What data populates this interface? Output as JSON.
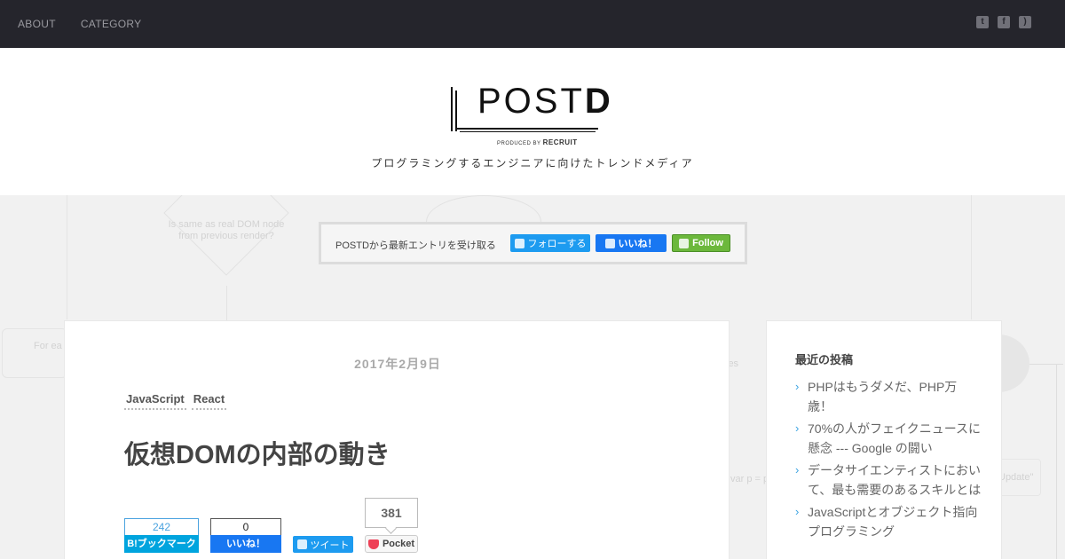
{
  "topnav": {
    "items": [
      "ABOUT",
      "CATEGORY"
    ],
    "social_icons": [
      "twitter-icon",
      "facebook-icon",
      "rss-icon"
    ]
  },
  "header": {
    "logo": {
      "brand": "POST",
      "brand_bold": "D",
      "produced_by": "PRODUCED BY",
      "recruit": "RECRUIT"
    },
    "tagline": "プログラミングするエンジニアに向けたトレンドメディア"
  },
  "hero": {
    "decision_text": "Is same as real DOM node from previous render?",
    "left_text": "For ea i",
    "right_text_1": "les",
    "right_text_2": "var p = p.remo",
    "right_text_3": "Update\""
  },
  "follow": {
    "text": "POSTDから最新エントリを受け取る",
    "twitter_label": "フォローする",
    "facebook_label": "いいね！",
    "feedly_label": "Follow"
  },
  "article": {
    "date": "2017年2月9日",
    "tags": [
      "JavaScript",
      "React"
    ],
    "title": "仮想DOMの内部の動き",
    "share": {
      "hatena_count": "242",
      "hatena_label": "B!ブックマーク",
      "facebook_count": "0",
      "facebook_label": "いいね！",
      "tweet_label": "ツイート",
      "pocket_count": "381",
      "pocket_label": "Pocket"
    }
  },
  "sidebar": {
    "title": "最近の投稿",
    "posts": [
      "PHPはもうダメだ、PHP万歳！",
      "70%の人がフェイクニュースに懸念 --- Google の闘い",
      "データサイエンティストにおいて、最も需要のあるスキルとは",
      "JavaScriptとオブジェクト指向プログラミング"
    ]
  },
  "colors": {
    "topbar": "#25252c",
    "twitter": "#1d9bf0",
    "facebook": "#1877f2",
    "feedly": "#6cb83c",
    "hatena": "#00a4de",
    "pocket": "#ee4056",
    "accent": "#3aa3e3"
  }
}
